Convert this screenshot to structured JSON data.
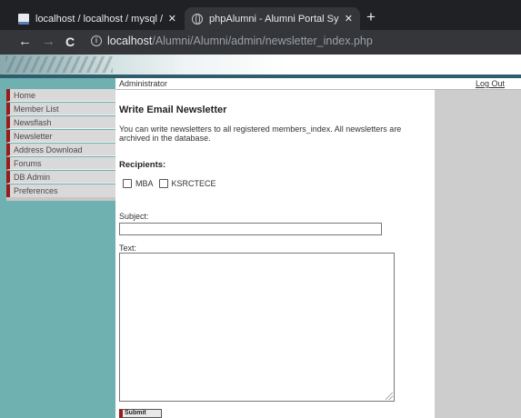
{
  "browser": {
    "tabs": [
      {
        "title": "localhost / localhost / mysql / us",
        "favicon": "phpmyadmin-icon",
        "active": false
      },
      {
        "title": "phpAlumni - Alumni Portal Syste",
        "favicon": "globe-icon",
        "active": true
      }
    ],
    "close_glyph": "✕",
    "new_tab_glyph": "+",
    "back_glyph": "←",
    "forward_glyph": "→",
    "reload_glyph": "C",
    "info_glyph": "i",
    "url_host": "localhost",
    "url_path": "/Alumni/Alumni/admin/newsletter_index.php"
  },
  "page": {
    "user": "Administrator",
    "logout_label": "Log Out",
    "sidebar": {
      "items": [
        {
          "label": "Home"
        },
        {
          "label": "Member List"
        },
        {
          "label": "Newsflash"
        },
        {
          "label": "Newsletter"
        },
        {
          "label": "Address Download"
        },
        {
          "label": "Forums"
        },
        {
          "label": "DB Admin"
        },
        {
          "label": "Preferences"
        }
      ]
    },
    "main": {
      "title": "Write Email Newsletter",
      "intro": "You can write newsletters to all registered members_index. All newsletters are archived in the database.",
      "recipients_label": "Recipients:",
      "recipients": [
        {
          "label": "MBA",
          "checked": false
        },
        {
          "label": "KSRCTECE",
          "checked": false
        }
      ],
      "subject_label": "Subject:",
      "subject_value": "",
      "text_label": "Text:",
      "text_value": "",
      "submit_label": "Submit"
    }
  },
  "colors": {
    "sidebar_bg": "#6fb0b0",
    "menu_accent": "#9b1b1b",
    "menu_bg": "#d9d9d9",
    "right_column_bg": "#cdcdcd",
    "chrome_dark": "#202124",
    "chrome_toolbar": "#35363a"
  }
}
